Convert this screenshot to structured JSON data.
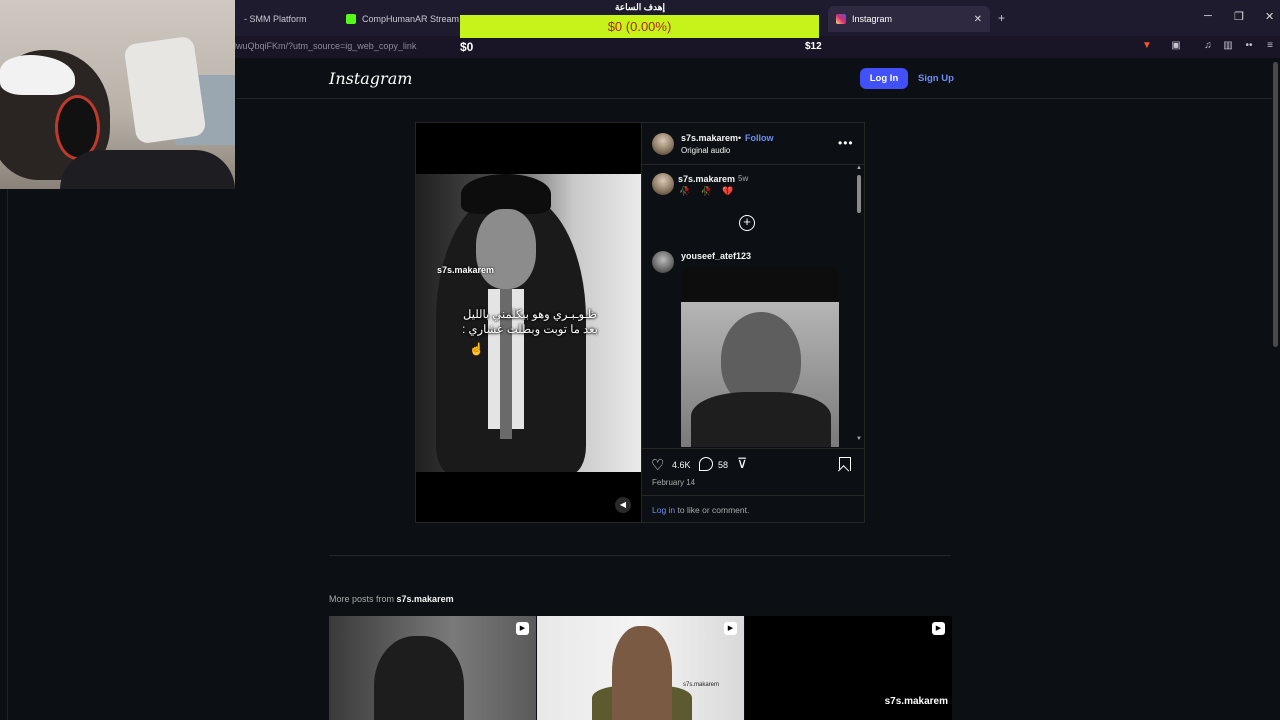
{
  "browser": {
    "tabs": [
      {
        "label": "- SMM Platform"
      },
      {
        "label": "CompHumanAR Stream - Wa"
      },
      {
        "label": "Instagram",
        "active": true
      }
    ],
    "url": "lwuQbqiFKm/?utm_source=ig_web_copy_link",
    "new_tab_glyph": "+",
    "close_glyph": "✕"
  },
  "overlay": {
    "title": "إهدف الساعة",
    "progress_text": "$0 (0.00%)",
    "progress_fraction": 0.0,
    "min_label": "$0",
    "max_label": "$12",
    "bar_color": "#c6f31a"
  },
  "header": {
    "logo": "Instagram",
    "login_label": "Log In",
    "signup_label": "Sign Up"
  },
  "post": {
    "author": "s7s.makarem",
    "follow_label": "Follow",
    "separator": "•",
    "audio": "Original audio",
    "video_watermark": "s7s.makarem",
    "caption_overlay": "ظـوـبـري وهو بيكلمني بالليل بعد ما توبت وبطلت عشاري :",
    "comments": [
      {
        "author": "s7s.makarem",
        "time": "5w",
        "text": "🥀 🥀 💔"
      },
      {
        "author": "youseef_atef123"
      }
    ],
    "likes": "4.6K",
    "comment_count": "58",
    "date": "February 14",
    "login_link": "Log in",
    "login_suffix": " to like or comment."
  },
  "more_posts": {
    "prefix": "More posts from ",
    "author": "s7s.makarem",
    "thumbnails": [
      {
        "kind": "reel"
      },
      {
        "kind": "reel",
        "watermark": "s7s.makarem"
      },
      {
        "kind": "reel",
        "watermark": "s7s.makarem"
      }
    ]
  },
  "colors": {
    "accent": "#4150f7",
    "link": "#6f8df6",
    "background": "#0c1014"
  }
}
